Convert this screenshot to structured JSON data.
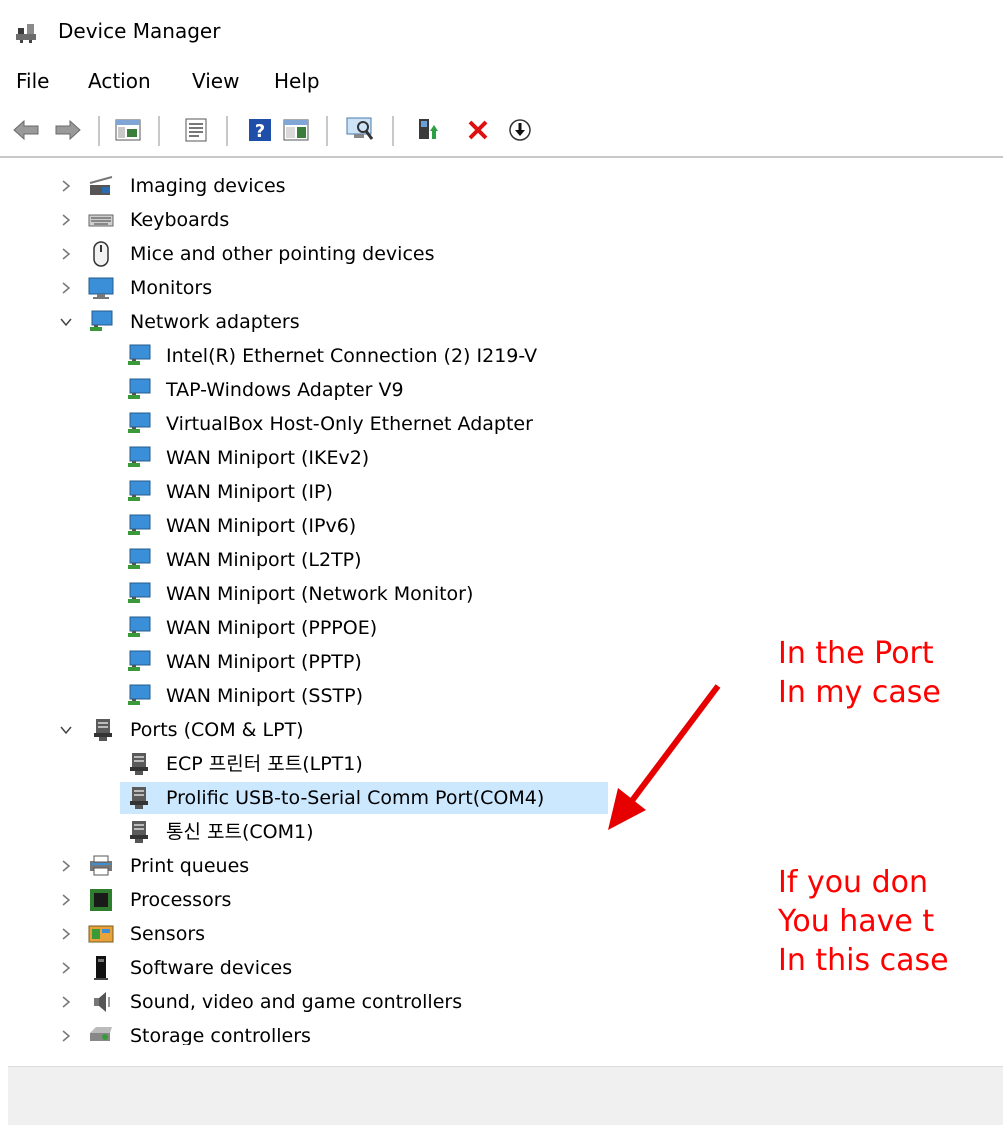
{
  "window": {
    "title": "Device Manager"
  },
  "menu": [
    "File",
    "Action",
    "View",
    "Help"
  ],
  "toolbar": {
    "buttons": [
      "back-icon",
      "forward-icon",
      "show-hide-console-tree-icon",
      "properties-icon",
      "help-icon",
      "action-pane-icon",
      "scan-hardware-changes-icon",
      "update-driver-icon",
      "uninstall-icon",
      "disable-device-icon"
    ]
  },
  "tree": {
    "imaging": "Imaging devices",
    "keyboards": "Keyboards",
    "mice": "Mice and other pointing devices",
    "monitors": "Monitors",
    "network": "Network adapters",
    "network_children": [
      "Intel(R) Ethernet Connection (2) I219-V",
      "TAP-Windows Adapter V9",
      "VirtualBox Host-Only Ethernet Adapter",
      "WAN Miniport (IKEv2)",
      "WAN Miniport (IP)",
      "WAN Miniport (IPv6)",
      "WAN Miniport (L2TP)",
      "WAN Miniport (Network Monitor)",
      "WAN Miniport (PPPOE)",
      "WAN Miniport (PPTP)",
      "WAN Miniport (SSTP)"
    ],
    "ports": "Ports (COM & LPT)",
    "ports_children": [
      "ECP 프린터 포트(LPT1)",
      "Prolific USB-to-Serial Comm Port(COM4)",
      "통신 포트(COM1)"
    ],
    "print_queues": "Print queues",
    "processors": "Processors",
    "sensors": "Sensors",
    "software": "Software devices",
    "sound": "Sound, video and game controllers",
    "storage": "Storage controllers"
  },
  "annotation": {
    "line1": "In the Port",
    "line2": "In my case",
    "line3": "If you don",
    "line4": "You have t",
    "line5": "In this case"
  },
  "colors": {
    "annotation": "#ff0000",
    "selection": "#cce8ff",
    "arrow": "#e60000"
  }
}
